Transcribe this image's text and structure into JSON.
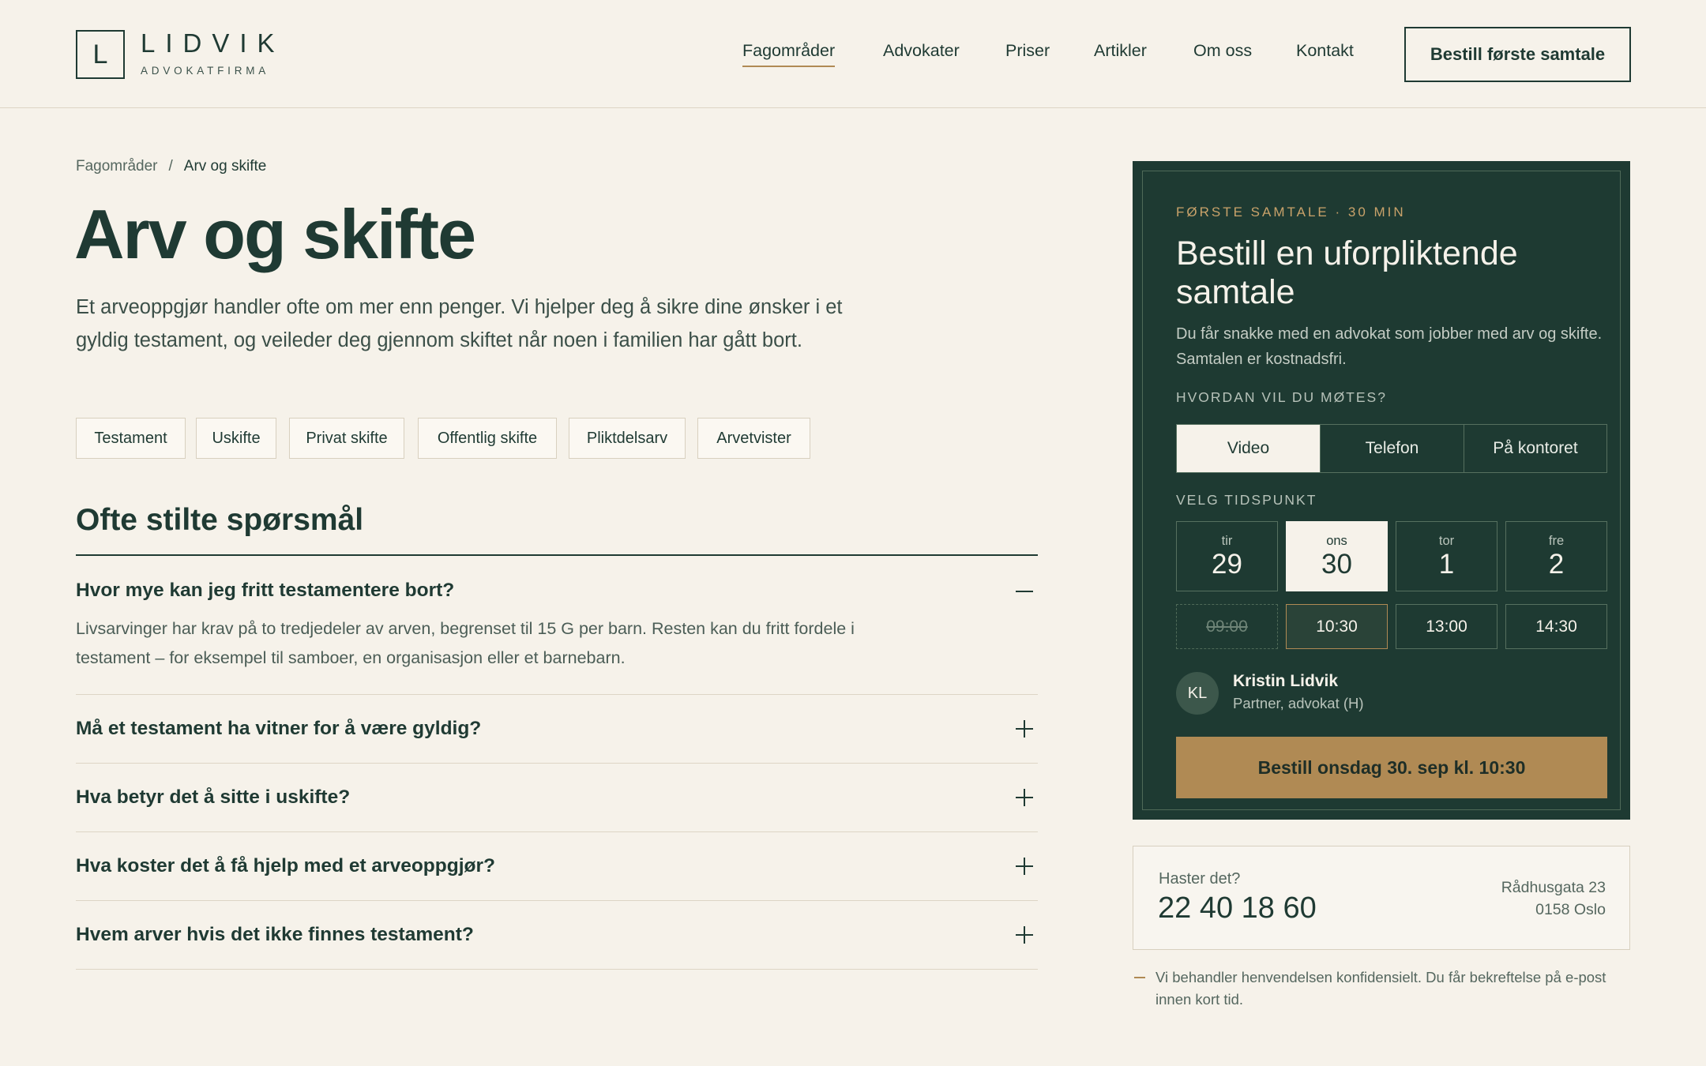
{
  "brand": {
    "logo_letter": "L",
    "name": "LIDVIK",
    "tagline": "ADVOKATFIRMA"
  },
  "nav": {
    "items": [
      {
        "label": "Fagområder",
        "active": true
      },
      {
        "label": "Advokater",
        "active": false
      },
      {
        "label": "Priser",
        "active": false
      },
      {
        "label": "Artikler",
        "active": false
      },
      {
        "label": "Om oss",
        "active": false
      },
      {
        "label": "Kontakt",
        "active": false
      }
    ],
    "cta": "Bestill første samtale"
  },
  "breadcrumb": {
    "parent": "Fagområder",
    "separator": "/",
    "current": "Arv og skifte"
  },
  "page": {
    "title": "Arv og skifte",
    "intro": "Et arveoppgjør handler ofte om mer enn penger. Vi hjelper deg å sikre dine ønsker i et gyldig testament, og veileder deg gjennom skiftet når noen i familien har gått bort."
  },
  "tags": [
    "Testament",
    "Uskifte",
    "Privat skifte",
    "Offentlig skifte",
    "Pliktdelsarv",
    "Arvetvister"
  ],
  "faq": {
    "title": "Ofte stilte spørsmål",
    "items": [
      {
        "question": "Hvor mye kan jeg fritt testamentere bort?",
        "answer": "Livsarvinger har krav på to tredjedeler av arven, begrenset til 15 G per barn. Resten kan du fritt fordele i testament – for eksempel til samboer, en organisasjon eller et barnebarn.",
        "expanded": true
      },
      {
        "question": "Må et testament ha vitner for å være gyldig?",
        "expanded": false
      },
      {
        "question": "Hva betyr det å sitte i uskifte?",
        "expanded": false
      },
      {
        "question": "Hva koster det å få hjelp med et arveoppgjør?",
        "expanded": false
      },
      {
        "question": "Hvem arver hvis det ikke finnes testament?",
        "expanded": false
      }
    ]
  },
  "booking": {
    "eyebrow": "FØRSTE SAMTALE · 30 MIN",
    "title": "Bestill en uforpliktende samtale",
    "description": "Du får snakke med en advokat som jobber med arv og skifte. Samtalen er kostnadsfri.",
    "meeting_label": "HVORDAN VIL DU MØTES?",
    "meeting_options": [
      "Video",
      "Telefon",
      "På kontoret"
    ],
    "meeting_selected": "Video",
    "time_label": "VELG TIDSPUNKT",
    "days": [
      {
        "weekday": "tir",
        "date": "29",
        "selected": false
      },
      {
        "weekday": "ons",
        "date": "30",
        "selected": true
      },
      {
        "weekday": "tor",
        "date": "1",
        "selected": false
      },
      {
        "weekday": "fre",
        "date": "2",
        "selected": false
      }
    ],
    "slots": [
      {
        "time": "09:00",
        "state": "unavailable"
      },
      {
        "time": "10:30",
        "state": "selected"
      },
      {
        "time": "13:00",
        "state": "available"
      },
      {
        "time": "14:30",
        "state": "available"
      }
    ],
    "lawyer": {
      "initials": "KL",
      "name": "Kristin Lidvik",
      "role": "Partner, advokat (H)"
    },
    "submit": "Bestill onsdag 30. sep kl. 10:30"
  },
  "contact": {
    "label": "Haster det?",
    "phone": "22 40 18 60",
    "address_line1": "Rådhusgata 23",
    "address_line2": "0158 Oslo"
  },
  "note": "Vi behandler henvendelsen konfidensielt. Du får bekreftelse på e-post innen kort tid.",
  "colors": {
    "background": "#f6f2ea",
    "primary": "#1f3a33",
    "panel": "#1e3a32",
    "accent": "#b08a54"
  },
  "icons": {
    "faq_expanded": "minus-icon",
    "faq_collapsed": "plus-icon"
  }
}
